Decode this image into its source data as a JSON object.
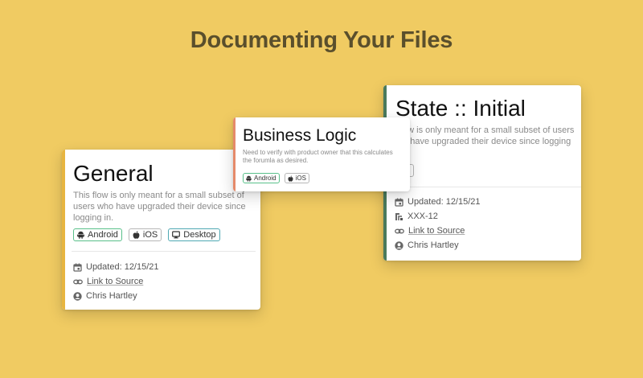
{
  "headline": "Documenting Your Files",
  "colors": {
    "background": "#F0CB62",
    "headline": "#5a4f2c",
    "general_accent": "#e7b540",
    "business_accent": "#e58a6a",
    "state_accent": "#4a7a5c",
    "tag_green": "#59c08a",
    "tag_teal": "#4fa8b3"
  },
  "cards": {
    "general": {
      "title": "General",
      "description": "This flow is only meant for a small subset of users who have upgraded their device since logging in.",
      "tags": {
        "android": "Android",
        "ios": "iOS",
        "desktop": "Desktop"
      },
      "updated": "Updated: 12/15/21",
      "link": "Link to Source",
      "author": "Chris Hartley"
    },
    "business": {
      "title": "Business Logic",
      "description": "Need to verify with product owner that this calculates the forumla as desired.",
      "tags": {
        "android": "Android",
        "ios": "iOS"
      }
    },
    "state": {
      "title": "State :: Initial",
      "description": "s flow is only meant for a small subset of users who have upgraded their device since logging in.",
      "tags": {
        "ios": "OS"
      },
      "updated": "Updated: 12/15/21",
      "ticket": "XXX-12",
      "link": "Link to Source",
      "author": "Chris Hartley"
    }
  }
}
